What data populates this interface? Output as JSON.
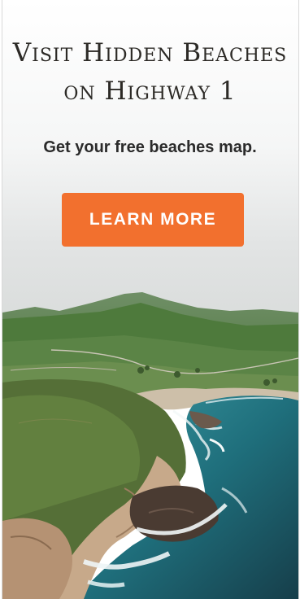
{
  "ad": {
    "title_line1": "Visit Hidden Beaches",
    "title_line2": "on Highway 1",
    "subtitle": "Get your free beaches map.",
    "cta_label": "LEARN MORE"
  },
  "colors": {
    "cta_background": "#f2702e",
    "cta_text": "#ffffff",
    "title_text": "#2c2a26",
    "ocean": "#1f6f7c",
    "hills": "#4e7a3c",
    "sky": "#e8e9ea"
  },
  "image": {
    "icon": "coastline-aerial-photo"
  }
}
